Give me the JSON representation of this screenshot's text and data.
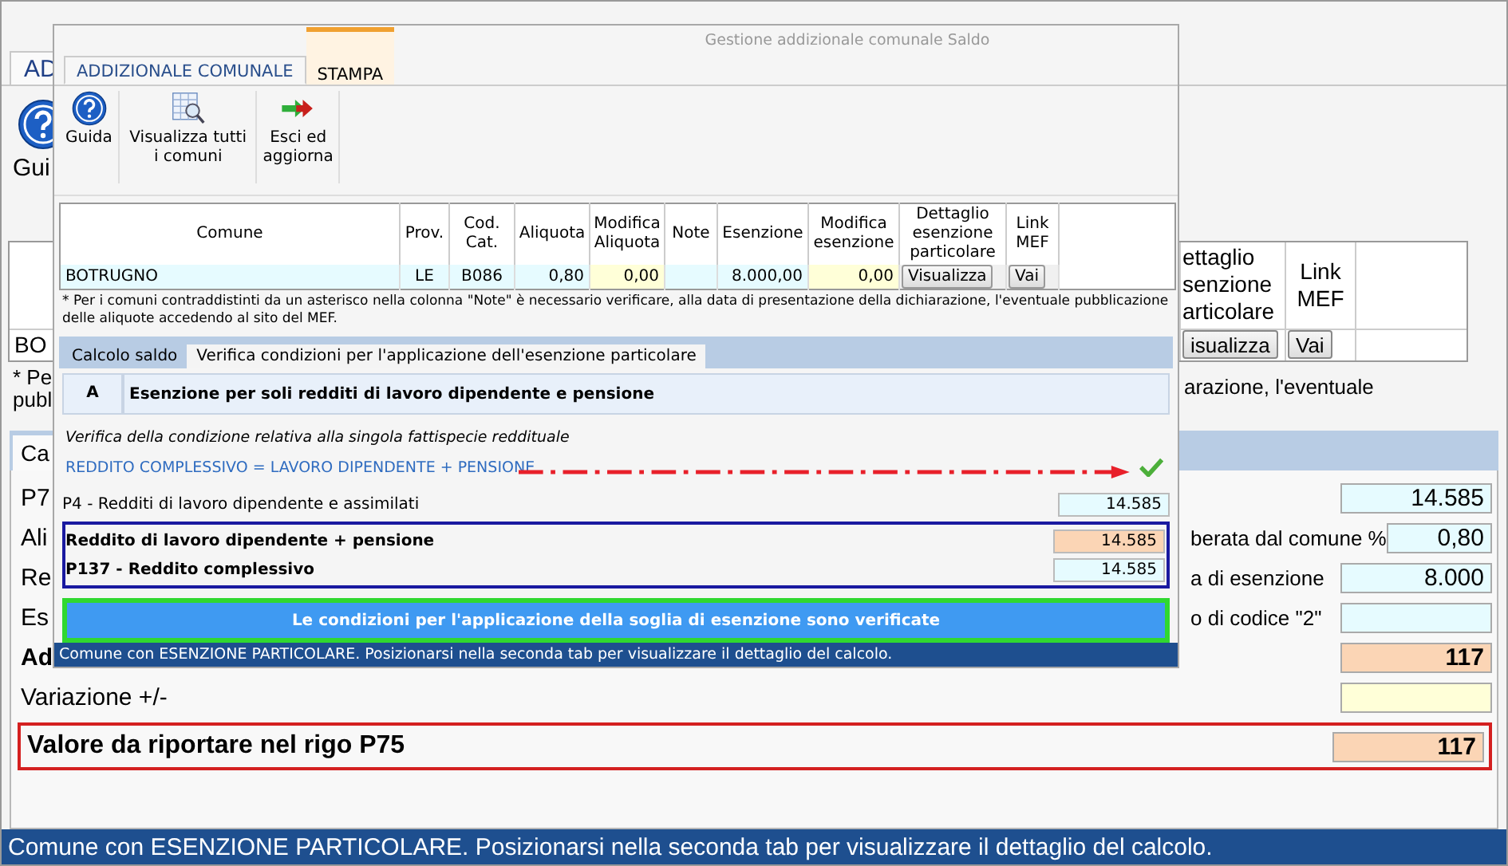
{
  "background": {
    "tabs": [
      {
        "label": "AD",
        "selected": true
      }
    ],
    "toolbar": [
      {
        "label": "Gui"
      }
    ],
    "table": {
      "columns": [
        "ettaglio senzione articolare",
        "Link MEF"
      ],
      "rows": [
        {
          "cell": "BO",
          "detail_button": "isualizza",
          "link_button": "Vai"
        }
      ]
    },
    "note_lines": [
      "* Pe",
      "publ"
    ],
    "note_tail": "arazione, l'eventuale",
    "sub_tabs": [
      {
        "label": "Ca",
        "selected": true
      }
    ],
    "rows": [
      {
        "left": "P7",
        "value": "14.585",
        "kind": "input"
      },
      {
        "left": "Ali",
        "right": "berata dal comune %",
        "value": "0,80",
        "kind": "input"
      },
      {
        "left": "Re",
        "right": "a di esenzione",
        "value": "8.000",
        "kind": "input"
      },
      {
        "left": "Es",
        "right": "o di codice \"2\"",
        "kind": "input"
      },
      {
        "left": "Ad",
        "value": "117",
        "kind": "computed",
        "bold": true
      },
      {
        "left": "Variazione +/-",
        "kind": "editable",
        "bold": false
      }
    ],
    "total": {
      "label": "Valore da riportare nel rigo P75",
      "value": "117"
    },
    "status": "Comune con ESENZIONE PARTICOLARE. Posizionarsi nella seconda tab per visualizzare il dettaglio del calcolo."
  },
  "dialog": {
    "title": "Gestione addizionale comunale Saldo",
    "tabs": [
      {
        "label": "ADDIZIONALE COMUNALE",
        "selected": true
      },
      {
        "label": "STAMPA",
        "selected": false
      }
    ],
    "toolbar": [
      {
        "label": "Guida"
      },
      {
        "label": "Visualizza tutti i comuni"
      },
      {
        "label": "Esci ed aggiorna"
      }
    ],
    "table": {
      "columns": [
        "Comune",
        "Prov.",
        "Cod. Cat.",
        "Aliquota",
        "Modifica Aliquota",
        "Note",
        "Esenzione",
        "Modifica esenzione",
        "Dettaglio esenzione particolare",
        "Link MEF"
      ],
      "rows": [
        {
          "comune": "BOTRUGNO",
          "prov": "LE",
          "cod_cat": "B086",
          "aliquota": "0,80",
          "modifica_aliquota": "0,00",
          "esenzione": "8.000,00",
          "modifica_esenzione": "0,00",
          "detail_button": "Visualizza",
          "link_button": "Vai"
        }
      ]
    },
    "note": "* Per i comuni contraddistinti da un asterisco nella colonna \"Note\" è necessario verificare,  alla data di presentazione della dichiarazione, l'eventuale pubblicazione delle aliquote accedendo al sito del MEF.",
    "sub_tabs": [
      {
        "label": "Calcolo saldo",
        "selected": false
      },
      {
        "label": "Verifica condizioni per l'applicazione dell'esenzione particolare",
        "selected": true
      }
    ],
    "section": {
      "letter": "A",
      "title": "Esenzione per soli redditi di lavoro dipendente e pensione"
    },
    "caption": "Verifica della condizione relativa alla singola fattispecie reddituale",
    "formula": "REDDITO COMPLESSIVO = LAVORO DIPENDENTE + PENSIONE",
    "formula_verified": true,
    "rows": [
      {
        "label": "P4 - Redditi di lavoro dipendente e assimilati",
        "value": "14.585",
        "kind": "input",
        "bold": false
      }
    ],
    "boxed_rows": [
      {
        "label": "Reddito di lavoro dipendente + pensione",
        "value": "14.585",
        "kind": "computed",
        "bold": true
      },
      {
        "label": "P137 - Reddito complessivo",
        "value": "14.585",
        "kind": "input",
        "bold": true
      }
    ],
    "result_button": "Le condizioni per l'applicazione della soglia di esenzione sono verificate",
    "status": "Comune con ESENZIONE PARTICOLARE. Posizionarsi nella seconda tab per visualizzare il dettaglio del calcolo."
  }
}
